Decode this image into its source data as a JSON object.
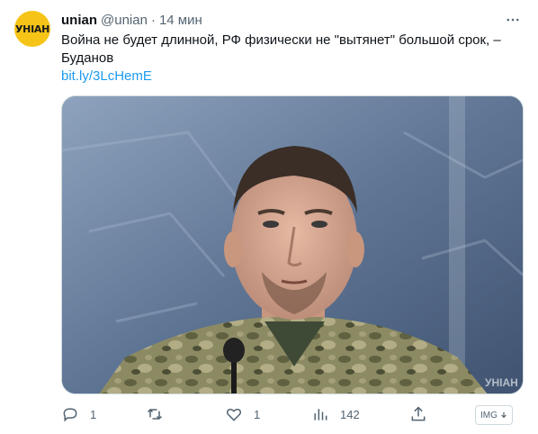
{
  "tweet": {
    "avatar_text": "УНІАН",
    "avatar_color": "#f6c417",
    "author_name": "unian",
    "author_handle": "@unian",
    "separator": "·",
    "timestamp": "14 мин",
    "text_line1": "Война не будет длинной, РФ физически не \"вытянет\" большой срок, –",
    "text_line2": "Буданов",
    "link_text": "bit.ly/3LcHemE",
    "more_icon": "more-horizontal-icon",
    "media_alt": "Фото: мужчина в военной форме у микрофона",
    "media_watermark": "УНІАН"
  },
  "actions": {
    "reply_count": "1",
    "retweet_count": "",
    "like_count": "1",
    "views_count": "142",
    "img_badge": "IMG",
    "icons": [
      "reply-icon",
      "retweet-icon",
      "like-icon",
      "views-icon",
      "share-icon"
    ]
  },
  "colors": {
    "link": "#1d9bf0",
    "secondary_text": "#536471",
    "primary_text": "#0f1419"
  }
}
